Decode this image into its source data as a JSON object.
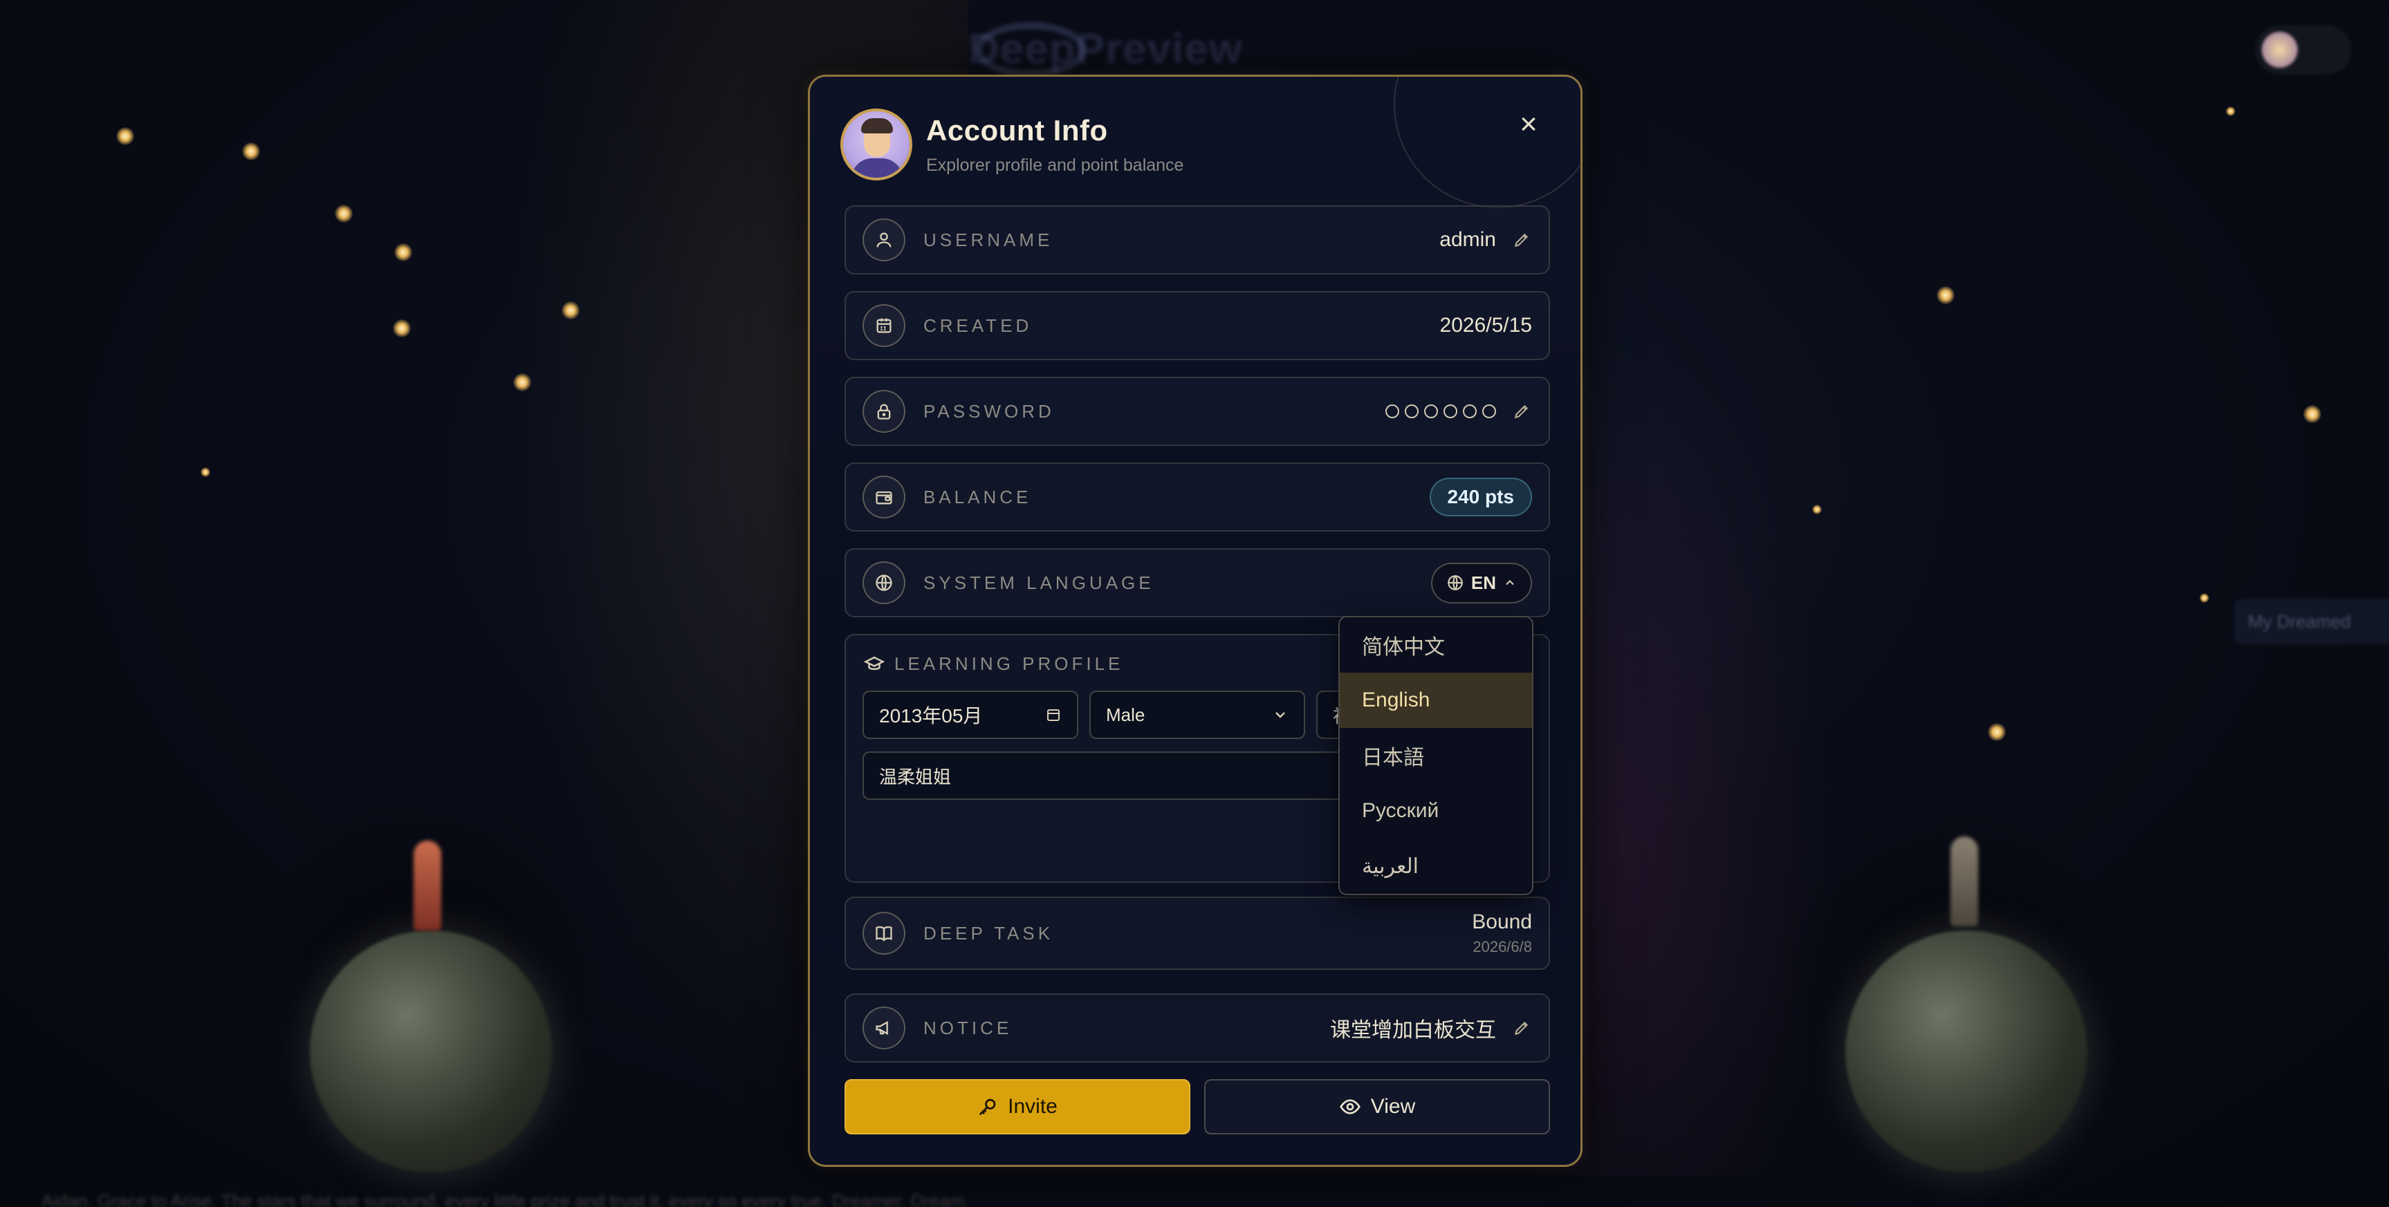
{
  "app": {
    "brand_name": "DeepPreview",
    "bottom_text": "Aidan, Grace to Arise. The stars that we surround, every little prize and trust it, every so every true. Dreamer. Dream."
  },
  "background": {
    "side_tab_label": "My Dreamed"
  },
  "modal": {
    "title": "Account Info",
    "subtitle": "Explorer profile and point balance",
    "close_label": "×"
  },
  "fields": {
    "username": {
      "label": "USERNAME",
      "value": "admin",
      "icon": "user-icon"
    },
    "created": {
      "label": "CREATED",
      "value": "2026/5/15",
      "icon": "calendar-icon"
    },
    "password": {
      "label": "PASSWORD",
      "masked_count": 6,
      "icon": "lock-icon"
    },
    "balance": {
      "label": "BALANCE",
      "value": "240 pts",
      "icon": "wallet-icon"
    },
    "language": {
      "label": "SYSTEM LANGUAGE",
      "value": "EN",
      "icon": "globe-icon"
    }
  },
  "learning_profile": {
    "label": "LEARNING PROFILE",
    "birth_month": "2013年05月",
    "gender": "Male",
    "third_field_partial": "初",
    "persona": "温柔姐姐"
  },
  "language_menu": {
    "options": [
      "简体中文",
      "English",
      "日本語",
      "Русский",
      "العربية"
    ],
    "selected": "English"
  },
  "deep_task": {
    "label": "DEEP TASK",
    "status": "Bound",
    "date": "2026/6/8",
    "icon": "book-icon"
  },
  "notice": {
    "label": "NOTICE",
    "value": "课堂增加白板交互",
    "icon": "megaphone-icon"
  },
  "actions": {
    "invite_label": "Invite",
    "view_label": "View"
  },
  "colors": {
    "accent": "#d9a10c",
    "border_gold": "#8f7440",
    "badge_teal": "#5aaabe"
  }
}
